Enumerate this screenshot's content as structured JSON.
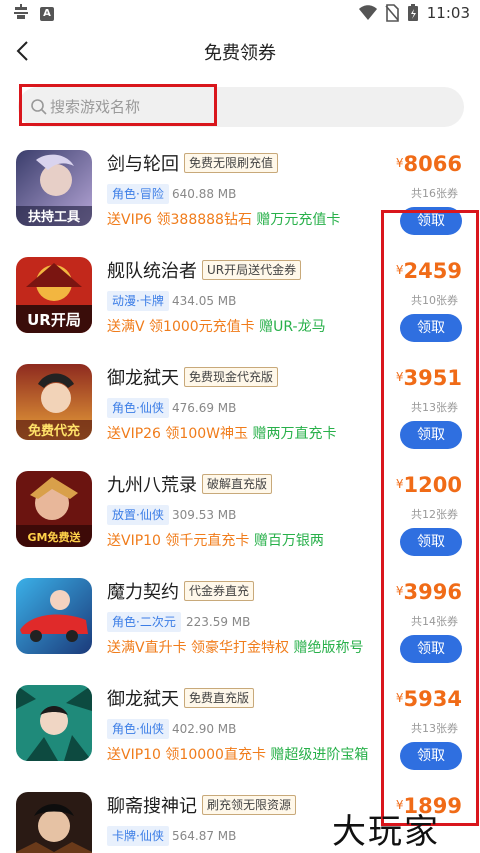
{
  "status_bar": {
    "time": "11:03",
    "icons": [
      "notification-bug-icon",
      "a-badge-icon",
      "wifi-icon",
      "no-sim-icon",
      "battery-icon"
    ],
    "badge_letter": "A"
  },
  "header": {
    "title": "免费领券"
  },
  "search": {
    "placeholder": "搜索游戏名称"
  },
  "colors": {
    "price": "#f06b17",
    "claim_button": "#2f6fe0",
    "perk_orange": "#f07c1b",
    "perk_green": "#28b04a",
    "genre_tag": "#3b7de6",
    "highlight": "#d9161c"
  },
  "games": [
    {
      "name": "剑与轮回",
      "tag": "免费无限刷充值",
      "genre": "角色·冒险",
      "size": "640.88 MB",
      "perk1": "送VIP6",
      "perk2": "领388888钻石",
      "perk3": "赠万元充值卡",
      "currency": "¥",
      "price": "8066",
      "coupons": "共16张券",
      "button": "领取",
      "icon_text": "扶持工具"
    },
    {
      "name": "舰队统治者",
      "tag": "UR开局送代金券",
      "genre": "动漫·卡牌",
      "size": "434.05 MB",
      "perk1": "送满V",
      "perk2": "领1000元充值卡",
      "perk3": "赠UR-龙马",
      "currency": "¥",
      "price": "2459",
      "coupons": "共10张券",
      "button": "领取",
      "icon_text": "UR开局"
    },
    {
      "name": "御龙弑天",
      "tag": "免费现金代充版",
      "genre": "角色·仙侠",
      "size": "476.69 MB",
      "perk1": "送VIP26",
      "perk2": "领100W神玉",
      "perk3": "赠两万直充卡",
      "currency": "¥",
      "price": "3951",
      "coupons": "共13张券",
      "button": "领取",
      "icon_text": "免费代充"
    },
    {
      "name": "九州八荒录",
      "tag": "破解直充版",
      "genre": "放置·仙侠",
      "size": "309.53 MB",
      "perk1": "送VIP10",
      "perk2": "领千元直充卡",
      "perk3": "赠百万银两",
      "currency": "¥",
      "price": "1200",
      "coupons": "共12张券",
      "button": "领取",
      "icon_text": "GM免费送"
    },
    {
      "name": "魔力契约",
      "tag": "代金券直充",
      "genre": "角色·二次元",
      "size": "223.59 MB",
      "perk1": "送满V直升卡",
      "perk2": "领豪华打金特权",
      "perk3": "赠绝版称号",
      "currency": "¥",
      "price": "3996",
      "coupons": "共14张券",
      "button": "领取",
      "icon_text": ""
    },
    {
      "name": "御龙弑天",
      "tag": "免费直充版",
      "genre": "角色·仙侠",
      "size": "402.90 MB",
      "perk1": "送VIP10",
      "perk2": "领10000直充卡",
      "perk3": "赠超级进阶宝箱",
      "currency": "¥",
      "price": "5934",
      "coupons": "共13张券",
      "button": "领取",
      "icon_text": ""
    },
    {
      "name": "聊斋搜神记",
      "tag": "刷充领无限资源",
      "genre": "卡牌·仙侠",
      "size": "564.87 MB",
      "perk1": "",
      "perk2": "",
      "perk3": "",
      "currency": "¥",
      "price": "1899",
      "coupons": "",
      "button": "",
      "icon_text": ""
    }
  ],
  "watermark": "大玩家"
}
